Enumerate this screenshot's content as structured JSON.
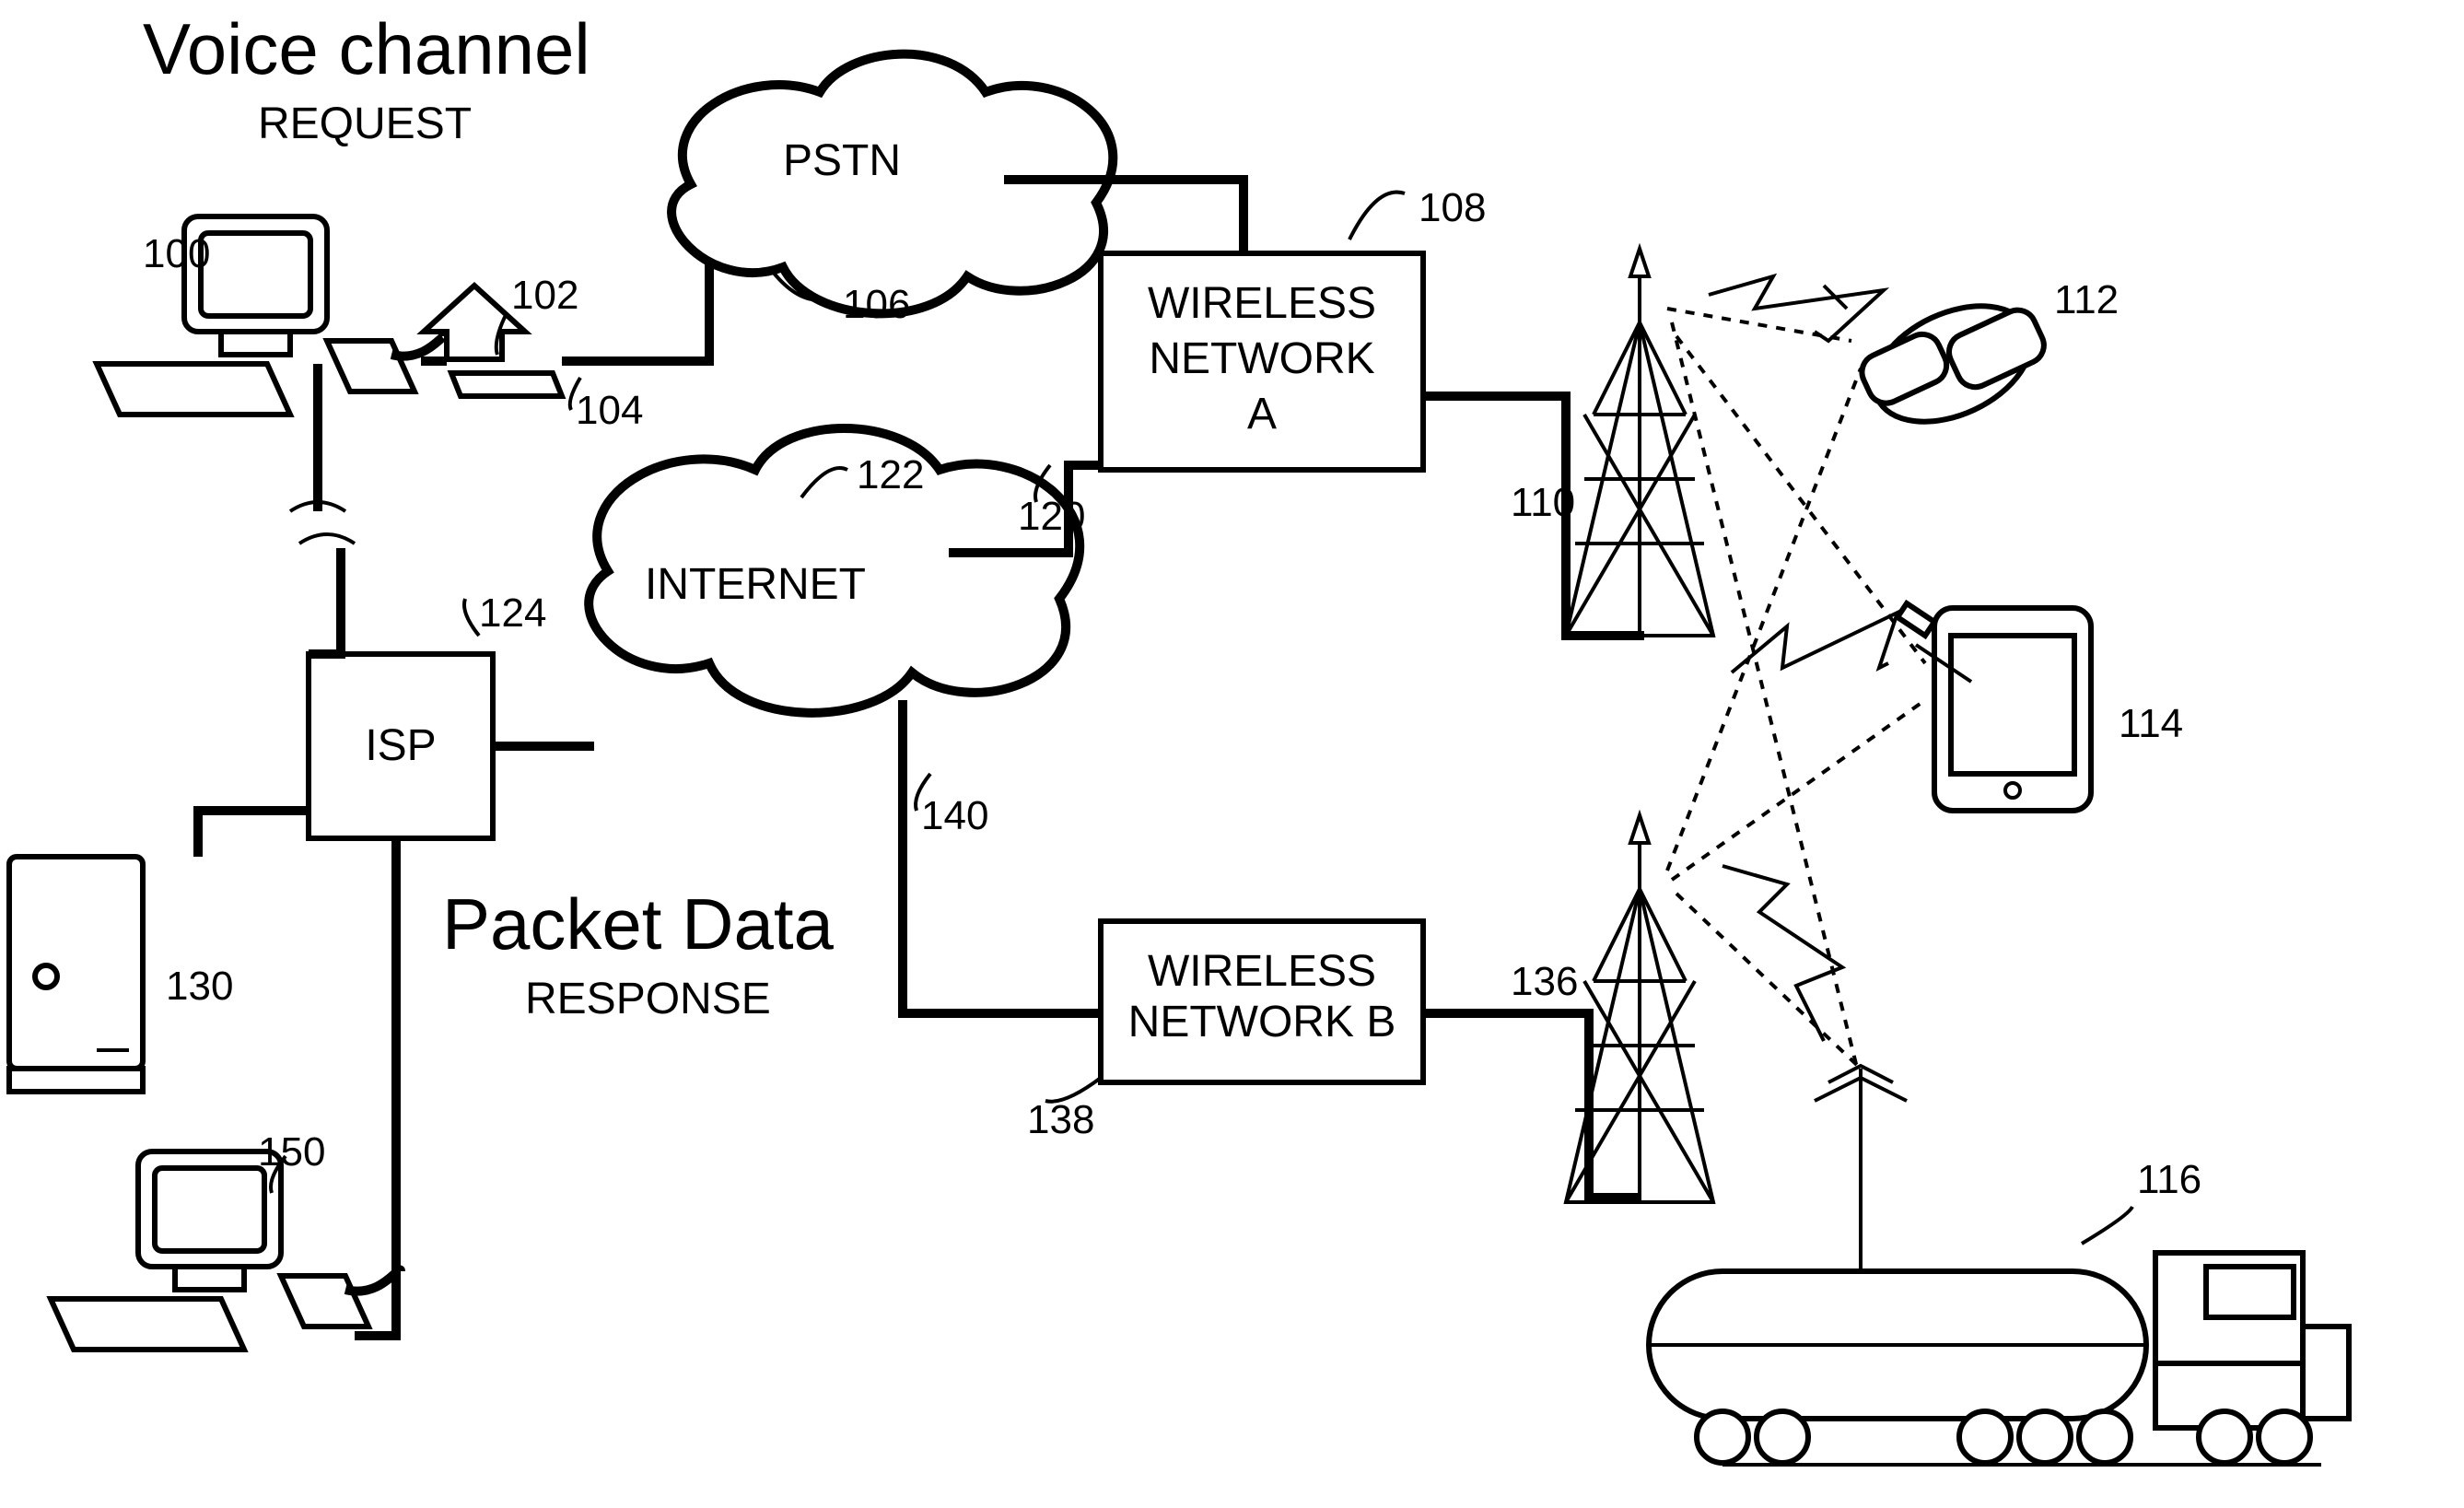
{
  "titles": {
    "voice_channel": "Voice channel",
    "request": "REQUEST",
    "packet_data": "Packet Data",
    "response": "RESPONSE"
  },
  "nodes": {
    "pstn": "PSTN",
    "internet": "INTERNET",
    "isp": "ISP",
    "wna_l1": "WIRELESS",
    "wna_l2": "NETWORK",
    "wna_l3": "A",
    "wnb_l1": "WIRELESS",
    "wnb_l2": "NETWORK B"
  },
  "refs": {
    "r100": "100",
    "r102": "102",
    "r104": "104",
    "r106": "106",
    "r108": "108",
    "r110": "110",
    "r112": "112",
    "r114": "114",
    "r116": "116",
    "r120": "120",
    "r122": "122",
    "r124": "124",
    "r130": "130",
    "r136": "136",
    "r138": "138",
    "r140": "140",
    "r150": "150"
  }
}
